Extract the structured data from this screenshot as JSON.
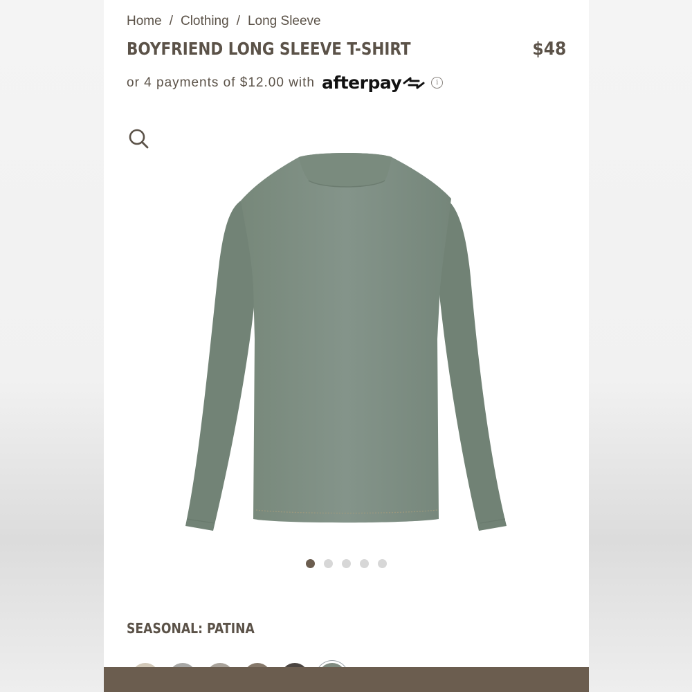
{
  "breadcrumb": {
    "items": [
      "Home",
      "Clothing",
      "Long Sleeve"
    ],
    "separator": "/"
  },
  "product": {
    "title": "BOYFRIEND LONG SLEEVE T-SHIRT",
    "price": "$48",
    "installments_text": "or 4 payments of $12.00 with",
    "payment_provider": "afterpay",
    "info_icon": "i"
  },
  "gallery": {
    "zoom_icon": "search-icon",
    "image_count": 5,
    "active_image": 1
  },
  "color": {
    "label": "SEASONAL: PATINA",
    "swatches": [
      "#d2c8b8",
      "#a7a7a5",
      "#a8a29a",
      "#85786a",
      "#4b4541",
      "#7f8b80"
    ],
    "selected_swatch": 6
  },
  "theme": {
    "text": "#5b5248",
    "accent": "#6b5d4f",
    "garment": "#7f8f80"
  }
}
